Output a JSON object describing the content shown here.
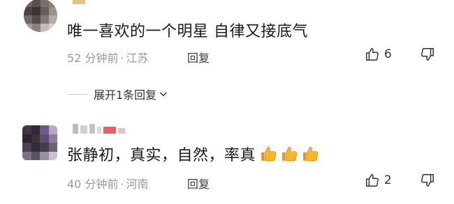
{
  "comments": [
    {
      "text": "唯一喜欢的一个明星 自律又接底气",
      "time": "52 分钟前",
      "location": "江苏",
      "reply_label": "回复",
      "likes": "6",
      "expand_label": "展开1条回复"
    },
    {
      "text": "张静初，真实，自然，率真",
      "time": "40 分钟前",
      "location": "河南",
      "reply_label": "回复",
      "likes": "2"
    }
  ],
  "separator": "·",
  "colors": {
    "meta_gray": "#9a9a9a",
    "thumb_yellow": "#f5a623",
    "username_red": "#e54545"
  },
  "icons": [
    "thumb-up-icon",
    "thumb-down-icon",
    "chevron-down-icon",
    "thumbs-up-emoji"
  ]
}
